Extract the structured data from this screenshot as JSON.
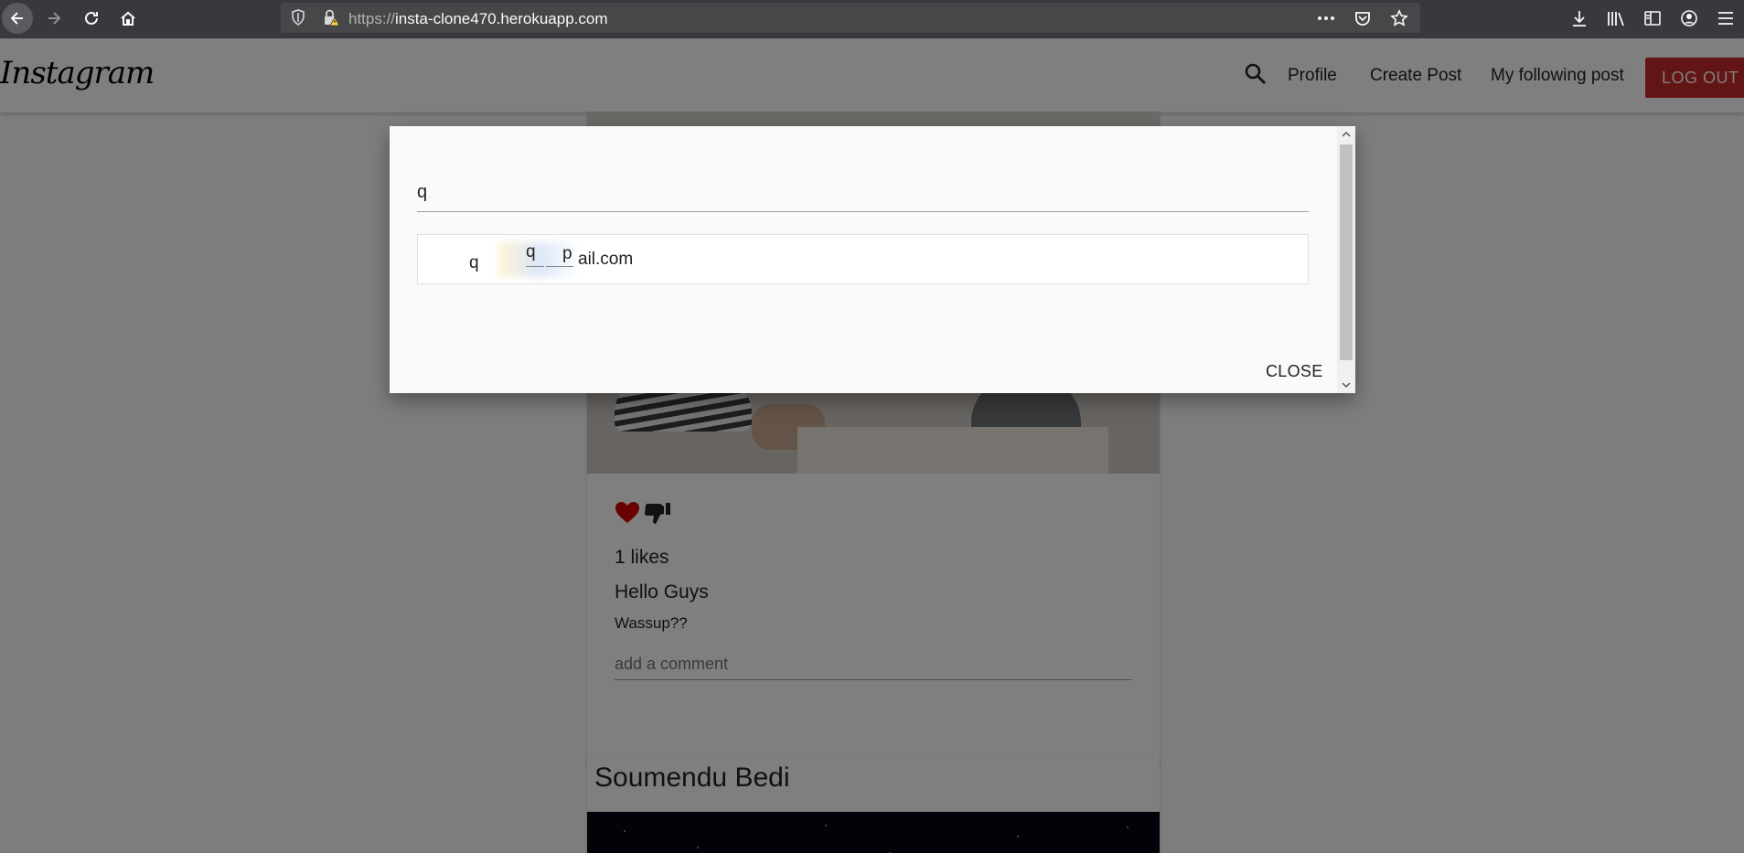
{
  "browser": {
    "url_scheme": "https://",
    "url_host": "insta-clone470.herokuapp.com"
  },
  "app": {
    "brand": "Instagram",
    "nav": {
      "profile": "Profile",
      "create_post": "Create Post",
      "following": "My following post",
      "logout": "LOG OUT"
    }
  },
  "post": {
    "likes": "1 likes",
    "title": "Hello Guys",
    "body": "Wassup??",
    "comment_placeholder": "add a comment"
  },
  "next_post": {
    "author": "Soumendu Bedi"
  },
  "search_modal": {
    "query": "q",
    "result_fragment_1": "q",
    "result_fragment_2": "q",
    "result_fragment_3": "p",
    "result_email_tail": "ail.com",
    "close_label": "CLOSE"
  },
  "colors": {
    "logout_bg": "#c62828",
    "like_heart": "#d50000"
  }
}
